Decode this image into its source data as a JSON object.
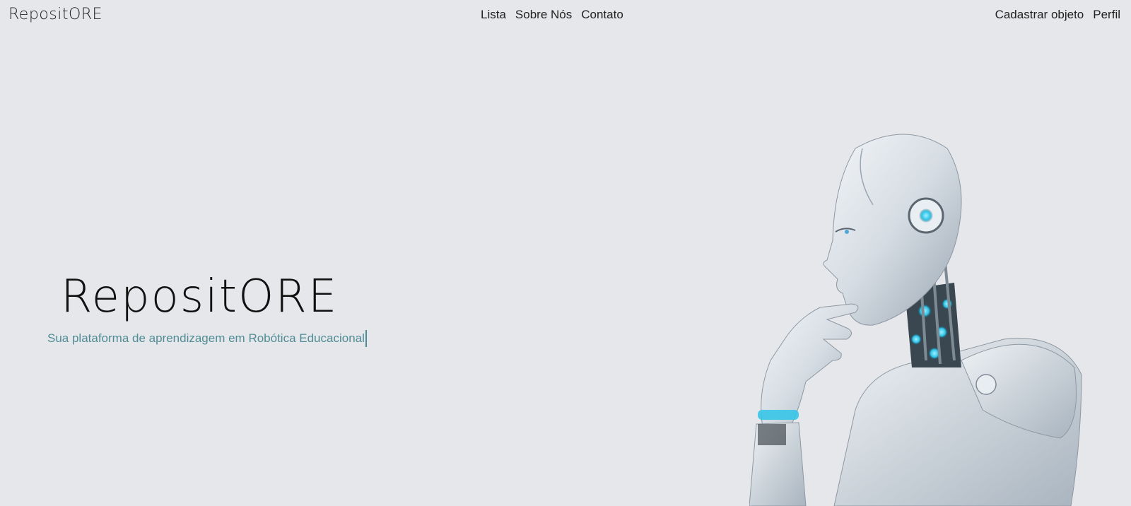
{
  "navbar": {
    "brand": "RepositORE",
    "center_links": [
      "Lista",
      "Sobre Nós",
      "Contato"
    ],
    "right_links": [
      "Cadastrar objeto",
      "Perfil"
    ]
  },
  "hero": {
    "title": "RepositORE",
    "subtitle": "Sua plataforma de aprendizagem em Robótica Educacional",
    "image": "robot-thinking-illustration"
  },
  "colors": {
    "background": "#e6e7ea",
    "accent": "#4f8c95",
    "text": "#222222",
    "robot_glow": "#2ec4e8"
  }
}
